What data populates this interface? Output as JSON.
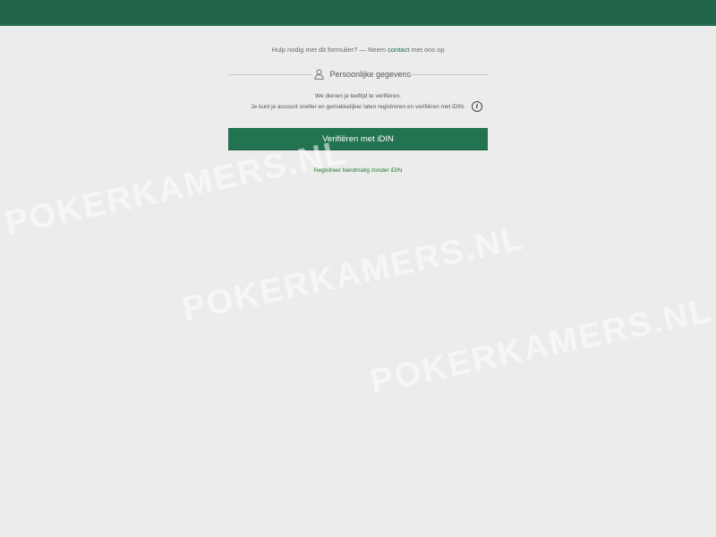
{
  "header": {
    "bar_color": "#21664a"
  },
  "help": {
    "prefix": "Hulp nodig met dit formulier? — Neem",
    "link": "contact",
    "suffix": "met ons op"
  },
  "section": {
    "icon": "user-icon",
    "title": "Persoonlijke gegevens"
  },
  "info": {
    "line1": "We dienen je leeftijd te verifiëren.",
    "line2": "Je kunt je account sneller en gemakkelijker laten registreren en verifiëren met iDIN.",
    "icon_glyph": "i"
  },
  "primary_button": {
    "label": "Verifiëren met iDIN",
    "color": "#22734f"
  },
  "manual_link": {
    "label": "Registreer handmatig zonder iDIN"
  },
  "watermark": {
    "text": "POKERKAMERS.NL"
  }
}
